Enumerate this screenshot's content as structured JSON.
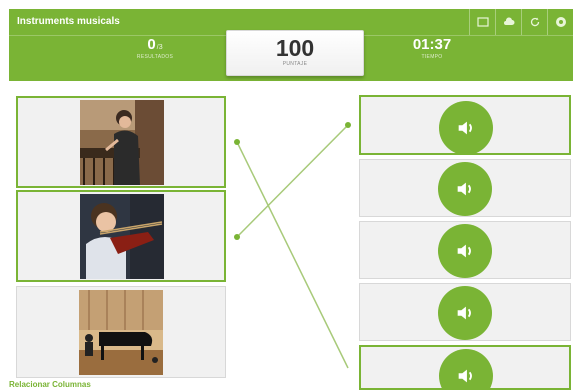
{
  "header": {
    "title": "Instruments musicals",
    "icons": [
      "fullscreen-icon",
      "cloud-icon",
      "refresh-icon",
      "settings-icon"
    ]
  },
  "stats": {
    "correct_value": "0",
    "correct_suffix": "/3",
    "correct_label": "RESULTADOS",
    "score_value": "100",
    "score_label": "PUNTAJE",
    "time_value": "01:37",
    "time_label": "TIEMPO"
  },
  "left_column": [
    {
      "image": "marimba-player-photo",
      "selected": true
    },
    {
      "image": "violin-child-photo",
      "selected": true
    },
    {
      "image": "piano-stage-photo",
      "selected": false
    }
  ],
  "right_column": [
    {
      "icon": "speaker-icon",
      "selected": true
    },
    {
      "icon": "speaker-icon",
      "selected": false
    },
    {
      "icon": "speaker-icon",
      "selected": false
    },
    {
      "icon": "speaker-icon",
      "selected": false
    },
    {
      "icon": "speaker-icon",
      "selected": true
    }
  ],
  "footer": {
    "label": "Relacionar Columnas"
  },
  "colors": {
    "accent": "#7ab435",
    "card": "#f1f1f1"
  }
}
